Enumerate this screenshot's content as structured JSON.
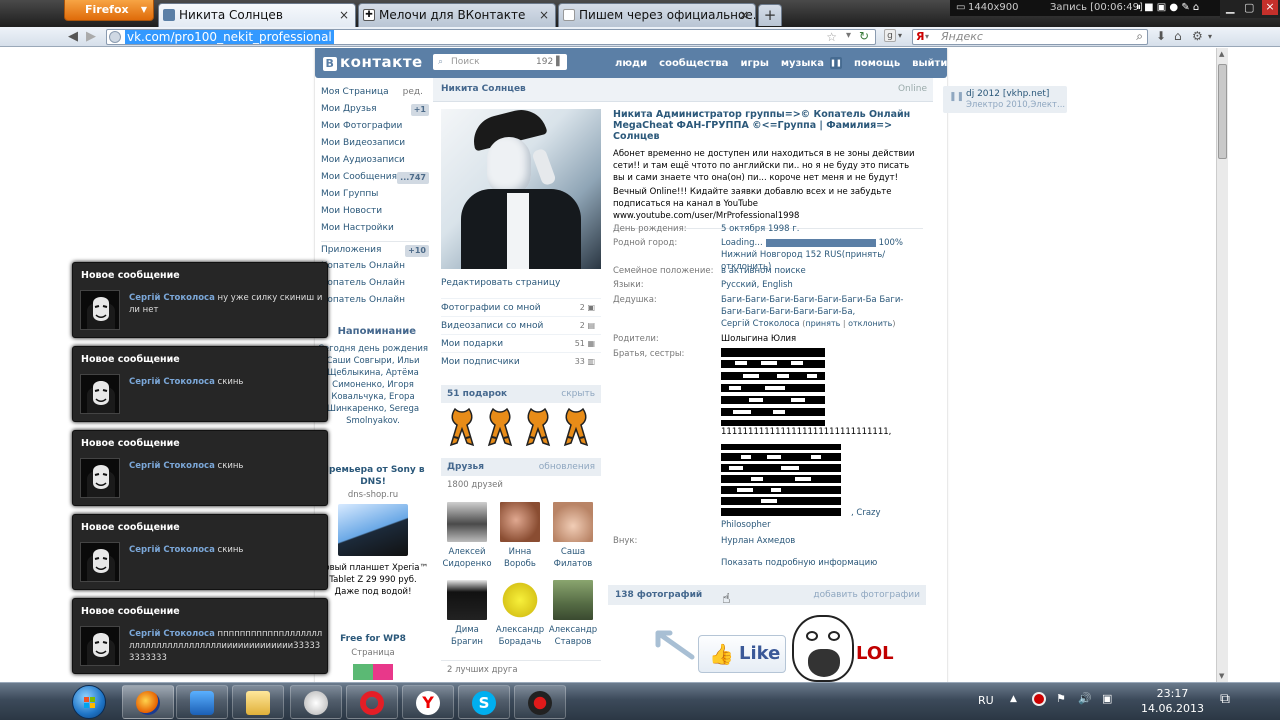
{
  "browser": {
    "firefox_label": "Firefox",
    "tabs": [
      {
        "title": "Никита Солнцев"
      },
      {
        "title": "Мелочи для ВКонтакте"
      },
      {
        "title": "Пишем через официальное..."
      }
    ],
    "url": "vk.com/pro100_nekit_professional",
    "search_placeholder": "Яндекс",
    "recorder": {
      "resolution": "1440x900",
      "status": "Запись [00:06:49]"
    }
  },
  "vk": {
    "logo": "контакте",
    "search_placeholder": "Поиск",
    "search_count": "192",
    "nav": [
      "люди",
      "сообщества",
      "игры",
      "музыка",
      "помощь",
      "выйти"
    ],
    "left_menu": [
      {
        "label": "Моя Страница",
        "extra": "ред."
      },
      {
        "label": "Мои Друзья",
        "badge": "+1"
      },
      {
        "label": "Мои Фотографии"
      },
      {
        "label": "Мои Видеозаписи"
      },
      {
        "label": "Мои Аудиозаписи"
      },
      {
        "label": "Мои Сообщения",
        "badge": "...747"
      },
      {
        "label": "Мои Группы"
      },
      {
        "label": "Мои Новости"
      },
      {
        "label": "Мои Настройки"
      },
      {
        "label": "Приложения",
        "badge": "+10"
      }
    ],
    "left_apps": [
      "Копатель Онлайн",
      "Копатель Онлайн",
      "Копатель Онлайн"
    ],
    "reminder": {
      "title": "Напоминание",
      "text": "Сегодня день рождения Саши Совгыри, Ильи Щеблыкина, Артёма Симоненко, Игоря Ковальчука, Егора Шинкаренко, Serega Smolnyakov."
    },
    "ad1": {
      "title": "Премьера от Sony в DNS!",
      "domain": "dns-shop.ru",
      "text": "Новый планшет Xperia™ Tablet Z 29 990 руб. Даже под водой!"
    },
    "ad2": {
      "title": "Free for WP8",
      "sub": "Страница"
    },
    "profile": {
      "name": "Никита Солнцев",
      "online": "Online",
      "status": "Никита Администратор группы=>© Копатель Онлайн MegaCheat ФАН-ГРУППА ©<=Группа | Фамилия=> Солнцев",
      "about1": "Абонет временно не доступен или находиться в не зоны действии сети!! и там ещё чтото по английски пи.. но я не буду это писать вы и сами знаете что она(он) пи... короче нет меня и не будут!",
      "about2": "Вечный Online!!! Кидайте заявки добавлю всех и не забудьте подписаться на канал в YouTube www.youtube.com/user/MrProfessional1998",
      "edit": "Редактировать страницу",
      "side_links": [
        {
          "label": "Фотографии со мной",
          "n": "2"
        },
        {
          "label": "Видеозаписи со мной",
          "n": "2"
        },
        {
          "label": "Мои подарки",
          "n": "51"
        },
        {
          "label": "Мои подписчики",
          "n": "33"
        }
      ],
      "gifts": {
        "title": "51 подарок",
        "action": "скрыть"
      },
      "friends": {
        "title": "Друзья",
        "action": "обновления",
        "count": "1800 друзей",
        "list": [
          {
            "first": "Алексей",
            "last": "Сидоренко"
          },
          {
            "first": "Инна",
            "last": "Воробь"
          },
          {
            "first": "Саша",
            "last": "Филатов"
          },
          {
            "first": "Дима",
            "last": "Брагин"
          },
          {
            "first": "Александр",
            "last": "Борадачь"
          },
          {
            "first": "Александр",
            "last": "Ставров"
          }
        ],
        "best": "2 лучших друга"
      },
      "fields": {
        "birthday_k": "День рождения:",
        "birthday_v": "5 октября 1998 г.",
        "city_k": "Родной город:",
        "loading": "Loading...",
        "loading_pct": "100%",
        "city_v": "Нижний Новгород 152 RUS(принять/отклонить)",
        "family_k": "Семейное положение:",
        "family_v": "в активном поиске",
        "lang_k": "Языки:",
        "lang_v": "Русский, English",
        "grand_k": "Дедушка:",
        "grand_v": "Баги-Баги-Баги-Баги-Баги-Баги-Ба Баги-Баги-Баги-Баги-Баги-Баги-Ба,",
        "grand_v2": "Сергій Стоколоса",
        "accept": "принять",
        "reject": "отклонить",
        "parents_k": "Родители:",
        "parents_v": "Шолыгина Юлия",
        "siblings_k": "Братья, сестры:",
        "ones": "1111111111111111111111111111111,",
        "crazy": ", Crazy",
        "philosopher": "Philosopher",
        "grandson_k": "Внук:",
        "grandson_v": "Нурлан Ахмедов",
        "more": "Показать подробную информацию"
      },
      "photos": {
        "title": "138 фотографий",
        "action": "добавить фотографии"
      },
      "like_label": "Like",
      "lol_label": "LOL"
    },
    "right_audio": {
      "title": "dj 2012 [vkhp.net]",
      "sub": "Электро 2010,Элект..."
    }
  },
  "notifications": [
    {
      "title": "Новое сообщение",
      "sender": "Сергій Стоколоса",
      "text": "ну уже силку скиниш или нет"
    },
    {
      "title": "Новое сообщение",
      "sender": "Сергій Стоколоса",
      "text": "скинь"
    },
    {
      "title": "Новое сообщение",
      "sender": "Сергій Стоколоса",
      "text": "скинь"
    },
    {
      "title": "Новое сообщение",
      "sender": "Сергій Стоколоса",
      "text": "скинь"
    },
    {
      "title": "Новое сообщение",
      "sender": "Сергій Стоколоса",
      "text": "ппппппппппппллллллллллллллллллллллллиииииииииииии333333333333"
    }
  ],
  "taskbar": {
    "lang": "RU",
    "time": "23:17",
    "date": "14.06.2013"
  },
  "colors": {
    "vk_blue": "#5b7fa6",
    "link": "#2b587a",
    "notif_bg": "#262626"
  }
}
